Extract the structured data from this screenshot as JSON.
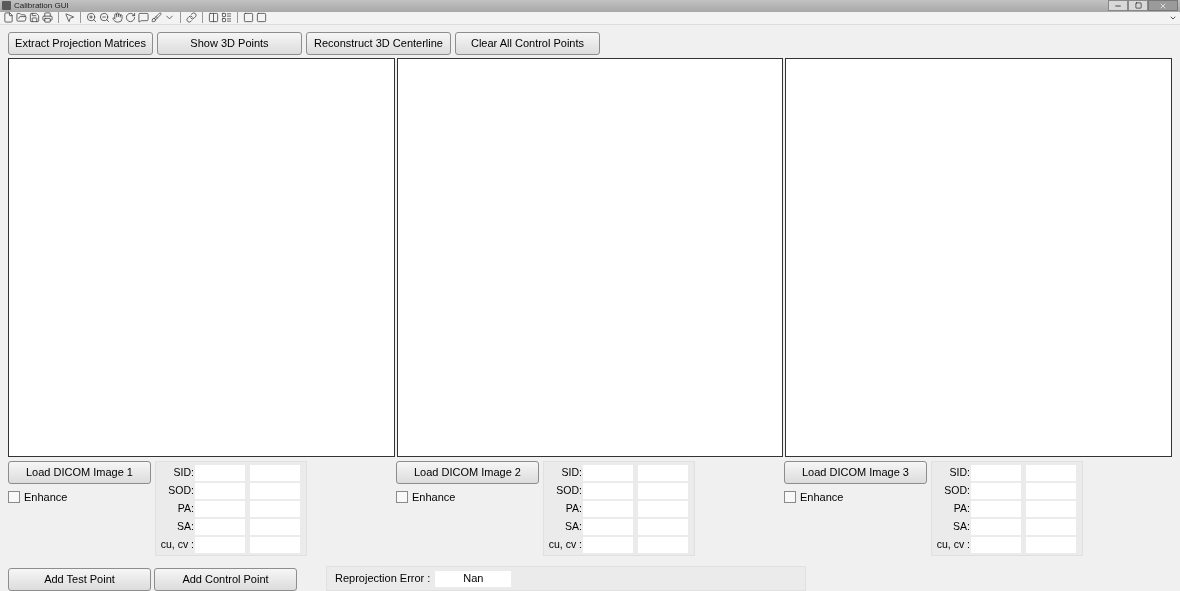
{
  "window": {
    "title": "Calibration GUI"
  },
  "toolbar_buttons": [
    "Extract Projection Matrices",
    "Show 3D Points",
    "Reconstruct 3D Centerline",
    "Clear All Control Points"
  ],
  "views": [
    {
      "load_button": "Load DICOM Image 1",
      "enhance": {
        "label": "Enhance",
        "checked": false
      },
      "params": [
        "SID:",
        "SOD:",
        "PA:",
        "SA:",
        "cu, cv :"
      ]
    },
    {
      "load_button": "Load DICOM Image 2",
      "enhance": {
        "label": "Enhance",
        "checked": false
      },
      "params": [
        "SID:",
        "SOD:",
        "PA:",
        "SA:",
        "cu, cv :"
      ]
    },
    {
      "load_button": "Load DICOM Image 3",
      "enhance": {
        "label": "Enhance",
        "checked": false
      },
      "params": [
        "SID:",
        "SOD:",
        "PA:",
        "SA:",
        "cu, cv :"
      ]
    }
  ],
  "bottom_buttons": [
    "Add Test Point",
    "Add Control Point"
  ],
  "reprojection": {
    "label": "Reprojection Error :",
    "value": "Nan"
  }
}
